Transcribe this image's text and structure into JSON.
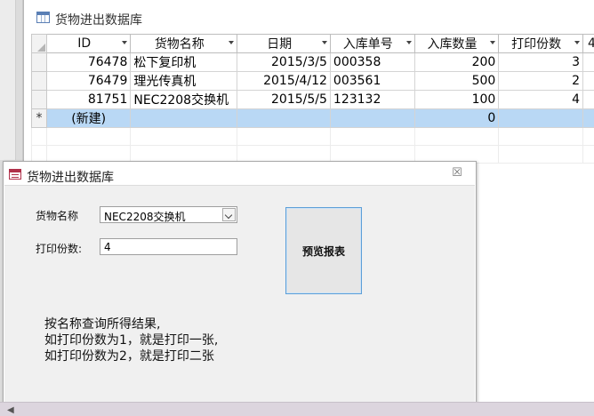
{
  "datasheet": {
    "title": "货物进出数据库",
    "columns": [
      "ID",
      "货物名称",
      "日期",
      "入库单号",
      "入库数量",
      "打印份数",
      "4"
    ],
    "rows": [
      {
        "id": "76478",
        "name": "松下复印机",
        "date": "2015/3/5",
        "order": "000358",
        "qty": "200",
        "copies": "3"
      },
      {
        "id": "76479",
        "name": "理光传真机",
        "date": "2015/4/12",
        "order": "003561",
        "qty": "500",
        "copies": "2"
      },
      {
        "id": "81751",
        "name": "NEC2208交换机",
        "date": "2015/5/5",
        "order": "123132",
        "qty": "100",
        "copies": "4"
      }
    ],
    "new_row": {
      "marker": "*",
      "label": "(新建)",
      "qty": "0"
    }
  },
  "form": {
    "title": "货物进出数据库",
    "close_glyph": "☒",
    "goods_label": "货物名称",
    "goods_value": "NEC2208交换机",
    "copies_label": "打印份数:",
    "copies_value": "4",
    "preview_button": "预览报表",
    "notes": [
      "按名称查询所得结果,",
      "如打印份数为1，就是打印一张,",
      "如打印份数为2，就是打印二张"
    ]
  },
  "colors": {
    "new_row_highlight": "#b9d8f5",
    "preview_border": "#5d9fd8",
    "form_icon": "#b0314a",
    "table_icon": "#5a7fb5"
  }
}
